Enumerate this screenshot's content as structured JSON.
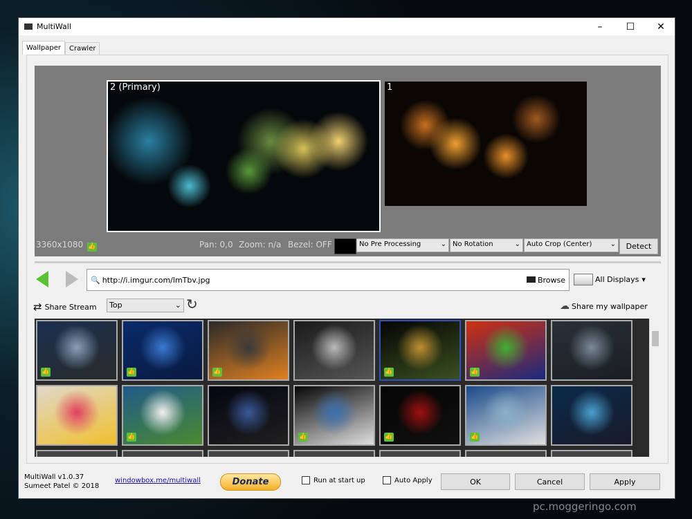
{
  "window": {
    "title": "MultiWall"
  },
  "tabs": [
    {
      "label": "Wallpaper",
      "active": true
    },
    {
      "label": "Crawler",
      "active": false
    }
  ],
  "preview": {
    "monitor_primary": "2 (Primary)",
    "monitor_secondary": "1",
    "resolution": "3360x1080",
    "pan": "Pan: 0,0",
    "zoom": "Zoom: n/a",
    "bezel": "Bezel: OFF",
    "bezel_color": "#000000",
    "pre_processing": "No Pre Processing",
    "rotation": "No Rotation",
    "crop": "Auto Crop (Center)",
    "detect_label": "Detect"
  },
  "url_bar": {
    "value": "http://i.imgur.com/lmTbv.jpg",
    "browse_label": "Browse",
    "displays_label": "All Displays"
  },
  "stream": {
    "share_stream_label": "Share Stream",
    "sort": "Top",
    "share_my_label": "Share my wallpaper"
  },
  "thumbnails": [
    {
      "colors": [
        "#1a3050",
        "#8aa0b8",
        "#2a2a2a"
      ],
      "liked": true
    },
    {
      "colors": [
        "#0a2a6a",
        "#3a7ad0",
        "#0a1a40"
      ],
      "liked": true
    },
    {
      "colors": [
        "#2a2a2a",
        "#3a3a3a",
        "#e08020"
      ],
      "liked": true
    },
    {
      "colors": [
        "#1a1a1a",
        "#bbbbbb",
        "#555555"
      ],
      "liked": false
    },
    {
      "colors": [
        "#050505",
        "#c09030",
        "#3a5020"
      ],
      "liked": true,
      "selected": true
    },
    {
      "colors": [
        "#d03010",
        "#40b030",
        "#1a2a80"
      ],
      "liked": true
    },
    {
      "colors": [
        "#2a3038",
        "#7a8a98",
        "#1a1e24"
      ],
      "liked": false
    },
    {
      "colors": [
        "#e0d8c8",
        "#e04060",
        "#f0c030"
      ],
      "liked": false
    },
    {
      "colors": [
        "#205a8a",
        "#f0f0f0",
        "#4a8a30"
      ],
      "liked": true
    },
    {
      "colors": [
        "#050510",
        "#3a5a9a",
        "#202020"
      ],
      "liked": false
    },
    {
      "colors": [
        "#050505",
        "#3a70b0",
        "#e0e0e0"
      ],
      "liked": true
    },
    {
      "colors": [
        "#050505",
        "#a01010",
        "#101010"
      ],
      "liked": true
    },
    {
      "colors": [
        "#1a4a8a",
        "#8ab0c8",
        "#e0e0e0"
      ],
      "liked": true
    },
    {
      "colors": [
        "#0a2a4a",
        "#4aa0d0",
        "#1a1a2a"
      ],
      "liked": false
    }
  ],
  "footer": {
    "version": "MultiWall v1.0.37",
    "author": "Sumeet Patel © 2018",
    "link": "windowbox.me/multiwall",
    "donate": "Donate",
    "run_at_startup": "Run at start up",
    "auto_apply": "Auto Apply",
    "ok": "OK",
    "cancel": "Cancel",
    "apply": "Apply"
  },
  "watermark": "pc.moggeringo.com"
}
